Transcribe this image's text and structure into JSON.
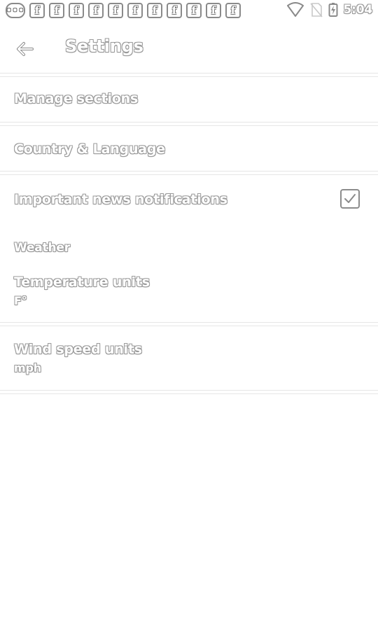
{
  "status_bar": {
    "icons": [
      "message-icon",
      "facebook-icon",
      "facebook-icon",
      "facebook-icon",
      "facebook-icon",
      "facebook-icon",
      "facebook-icon",
      "facebook-icon",
      "facebook-icon",
      "facebook-icon",
      "facebook-icon",
      "facebook-icon"
    ],
    "fb_glyph": "f",
    "msg_glyph": "•••",
    "time": "5:04"
  },
  "appbar": {
    "title": "Settings"
  },
  "settings": {
    "manage_sections": "Manage sections",
    "country_language": "Country & Language",
    "important_news": "Important news notifications",
    "important_news_checked": true,
    "weather_header": "Weather",
    "temperature_units": "Temperature units",
    "temperature_value": "F°",
    "wind_speed_units": "Wind speed units",
    "wind_speed_value": "mph"
  }
}
